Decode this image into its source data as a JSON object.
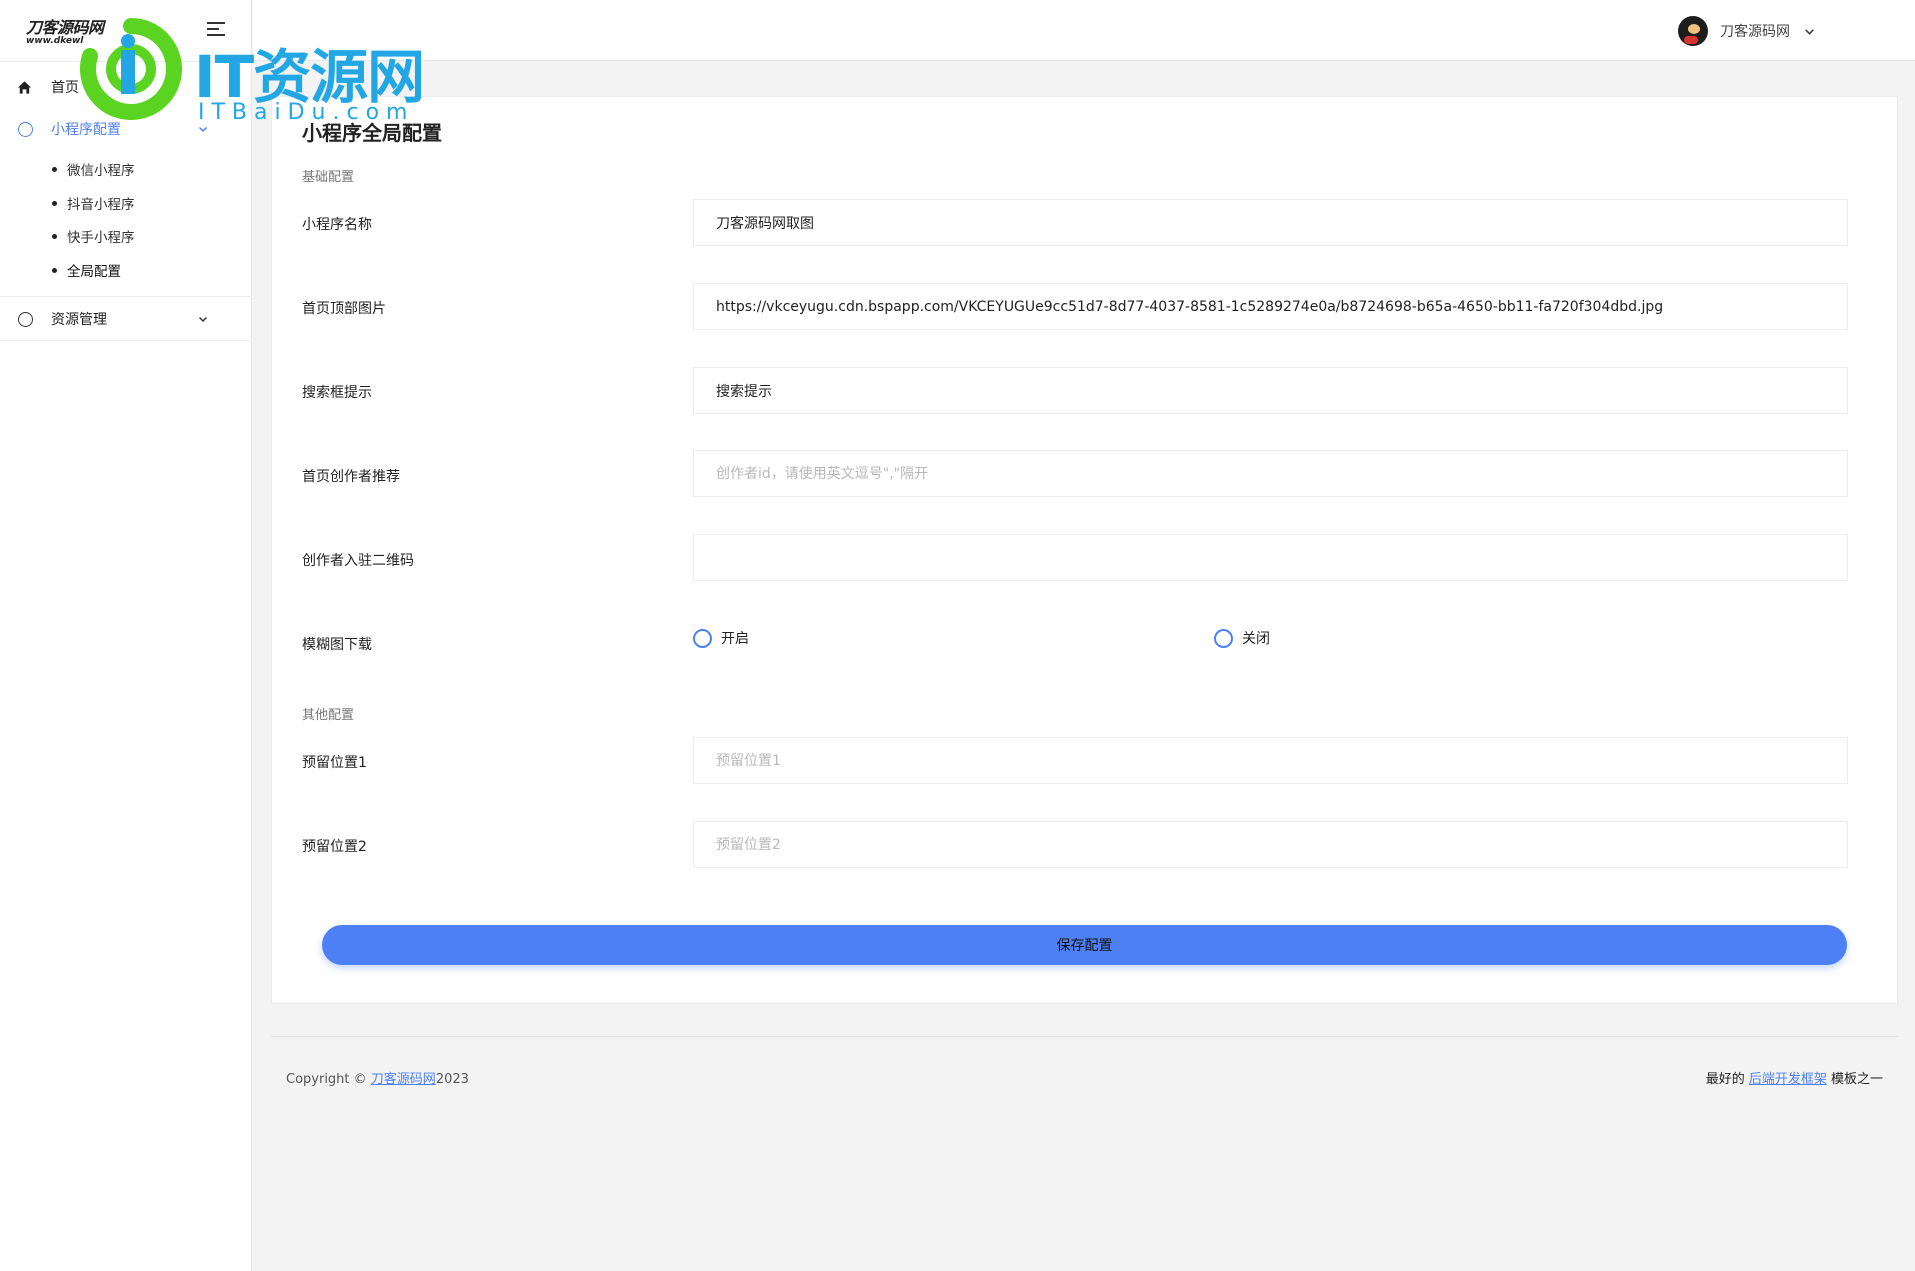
{
  "brand": {
    "name": "刀客源码网",
    "url": "www.dkewl"
  },
  "watermark": {
    "text": "IT资源网",
    "sub": "ITBaiDu.com"
  },
  "header": {
    "user_name": "刀客源码网"
  },
  "sidebar": {
    "items": [
      {
        "label": "首页",
        "icon": "home-icon"
      },
      {
        "label": "小程序配置",
        "icon": "circle-icon",
        "expanded": true,
        "children": [
          "微信小程序",
          "抖音小程序",
          "快手小程序",
          "全局配置"
        ]
      },
      {
        "label": "资源管理",
        "icon": "circle-icon",
        "expanded": false
      }
    ]
  },
  "page": {
    "title": "小程序全局配置",
    "section_basic": "基础配置",
    "section_other": "其他配置",
    "fields": {
      "app_name": {
        "label": "小程序名称",
        "value": "刀客源码网取图",
        "placeholder": ""
      },
      "top_image": {
        "label": "首页顶部图片",
        "value": "https://vkceyugu.cdn.bspapp.com/VKCEYUGUe9cc51d7-8d77-4037-8581-1c5289274e0a/b8724698-b65a-4650-bb11-fa720f304dbd.jpg",
        "placeholder": ""
      },
      "search_hint": {
        "label": "搜索框提示",
        "value": "搜索提示",
        "placeholder": ""
      },
      "recommend_creators": {
        "label": "首页创作者推荐",
        "value": "",
        "placeholder": "创作者id，请使用英文逗号\",\"隔开"
      },
      "creator_qrcode": {
        "label": "创作者入驻二维码",
        "value": "",
        "placeholder": ""
      },
      "blur_download": {
        "label": "模糊图下载",
        "options": [
          "开启",
          "关闭"
        ],
        "selected": null
      },
      "reserve1": {
        "label": "预留位置1",
        "value": "",
        "placeholder": "预留位置1"
      },
      "reserve2": {
        "label": "预留位置2",
        "value": "",
        "placeholder": "预留位置2"
      }
    },
    "save_label": "保存配置"
  },
  "footer": {
    "copyright_prefix": "Copyright © ",
    "copyright_link": "刀客源码网",
    "copyright_year": "2023",
    "right_prefix": "最好的 ",
    "right_link": "后端开发框架",
    "right_suffix": " 模板之一"
  },
  "colors": {
    "accent": "#4e80f5",
    "watermark_blue": "#22a7e4",
    "watermark_green": "#5ad321"
  }
}
